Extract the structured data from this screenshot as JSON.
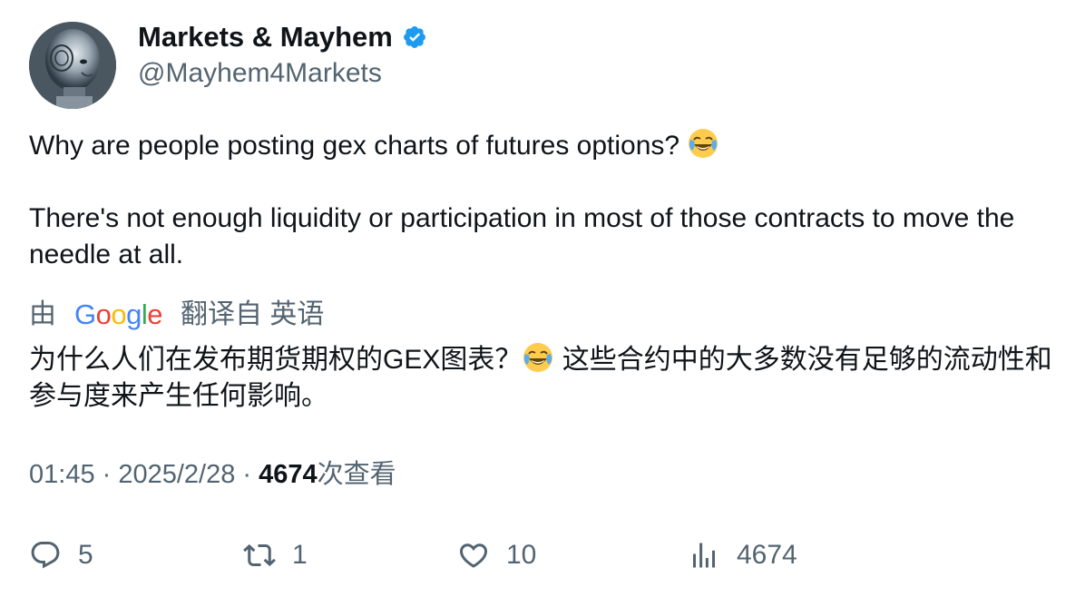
{
  "author": {
    "display_name": "Markets & Mayhem",
    "handle": "@Mayhem4Markets",
    "verified": true,
    "verified_color": "#1d9bf0"
  },
  "tweet": {
    "line1": "Why are people posting gex charts of futures options? ",
    "line1_emoji": "face-with-tears-of-joy-emoji",
    "line2": "There's not enough liquidity or participation in most of those contracts to move the needle at all."
  },
  "translation": {
    "prefix": "由",
    "provider": "Google",
    "suffix": "翻译自 英语",
    "text_part1": "为什么人们在发布期货期权的GEX图表？",
    "text_part2": " 这些合约中的大多数没有足够的流动性和参与度来产生任何影响。"
  },
  "meta": {
    "time": "01:45",
    "separator": " · ",
    "date": "2025/2/28",
    "views_count": "4674",
    "views_label": "次查看"
  },
  "actions": {
    "replies": "5",
    "retweets": "1",
    "likes": "10",
    "views": "4674"
  },
  "colors": {
    "text": "#0f1419",
    "secondary": "#536471",
    "google_blue": "#4285F4",
    "google_red": "#EA4335",
    "google_yellow": "#FBBC05",
    "google_green": "#34A853"
  }
}
